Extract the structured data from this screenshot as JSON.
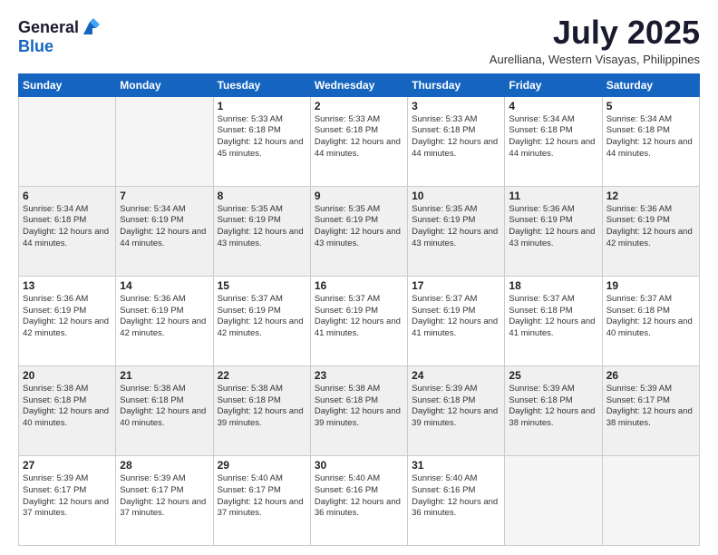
{
  "header": {
    "logo_line1": "General",
    "logo_line2": "Blue",
    "month": "July 2025",
    "location": "Aurelliana, Western Visayas, Philippines"
  },
  "weekdays": [
    "Sunday",
    "Monday",
    "Tuesday",
    "Wednesday",
    "Thursday",
    "Friday",
    "Saturday"
  ],
  "weeks": [
    [
      {
        "day": "",
        "sunrise": "",
        "sunset": "",
        "daylight": "",
        "empty": true
      },
      {
        "day": "",
        "sunrise": "",
        "sunset": "",
        "daylight": "",
        "empty": true
      },
      {
        "day": "1",
        "sunrise": "Sunrise: 5:33 AM",
        "sunset": "Sunset: 6:18 PM",
        "daylight": "Daylight: 12 hours and 45 minutes.",
        "empty": false
      },
      {
        "day": "2",
        "sunrise": "Sunrise: 5:33 AM",
        "sunset": "Sunset: 6:18 PM",
        "daylight": "Daylight: 12 hours and 44 minutes.",
        "empty": false
      },
      {
        "day": "3",
        "sunrise": "Sunrise: 5:33 AM",
        "sunset": "Sunset: 6:18 PM",
        "daylight": "Daylight: 12 hours and 44 minutes.",
        "empty": false
      },
      {
        "day": "4",
        "sunrise": "Sunrise: 5:34 AM",
        "sunset": "Sunset: 6:18 PM",
        "daylight": "Daylight: 12 hours and 44 minutes.",
        "empty": false
      },
      {
        "day": "5",
        "sunrise": "Sunrise: 5:34 AM",
        "sunset": "Sunset: 6:18 PM",
        "daylight": "Daylight: 12 hours and 44 minutes.",
        "empty": false
      }
    ],
    [
      {
        "day": "6",
        "sunrise": "Sunrise: 5:34 AM",
        "sunset": "Sunset: 6:18 PM",
        "daylight": "Daylight: 12 hours and 44 minutes.",
        "empty": false
      },
      {
        "day": "7",
        "sunrise": "Sunrise: 5:34 AM",
        "sunset": "Sunset: 6:19 PM",
        "daylight": "Daylight: 12 hours and 44 minutes.",
        "empty": false
      },
      {
        "day": "8",
        "sunrise": "Sunrise: 5:35 AM",
        "sunset": "Sunset: 6:19 PM",
        "daylight": "Daylight: 12 hours and 43 minutes.",
        "empty": false
      },
      {
        "day": "9",
        "sunrise": "Sunrise: 5:35 AM",
        "sunset": "Sunset: 6:19 PM",
        "daylight": "Daylight: 12 hours and 43 minutes.",
        "empty": false
      },
      {
        "day": "10",
        "sunrise": "Sunrise: 5:35 AM",
        "sunset": "Sunset: 6:19 PM",
        "daylight": "Daylight: 12 hours and 43 minutes.",
        "empty": false
      },
      {
        "day": "11",
        "sunrise": "Sunrise: 5:36 AM",
        "sunset": "Sunset: 6:19 PM",
        "daylight": "Daylight: 12 hours and 43 minutes.",
        "empty": false
      },
      {
        "day": "12",
        "sunrise": "Sunrise: 5:36 AM",
        "sunset": "Sunset: 6:19 PM",
        "daylight": "Daylight: 12 hours and 42 minutes.",
        "empty": false
      }
    ],
    [
      {
        "day": "13",
        "sunrise": "Sunrise: 5:36 AM",
        "sunset": "Sunset: 6:19 PM",
        "daylight": "Daylight: 12 hours and 42 minutes.",
        "empty": false
      },
      {
        "day": "14",
        "sunrise": "Sunrise: 5:36 AM",
        "sunset": "Sunset: 6:19 PM",
        "daylight": "Daylight: 12 hours and 42 minutes.",
        "empty": false
      },
      {
        "day": "15",
        "sunrise": "Sunrise: 5:37 AM",
        "sunset": "Sunset: 6:19 PM",
        "daylight": "Daylight: 12 hours and 42 minutes.",
        "empty": false
      },
      {
        "day": "16",
        "sunrise": "Sunrise: 5:37 AM",
        "sunset": "Sunset: 6:19 PM",
        "daylight": "Daylight: 12 hours and 41 minutes.",
        "empty": false
      },
      {
        "day": "17",
        "sunrise": "Sunrise: 5:37 AM",
        "sunset": "Sunset: 6:19 PM",
        "daylight": "Daylight: 12 hours and 41 minutes.",
        "empty": false
      },
      {
        "day": "18",
        "sunrise": "Sunrise: 5:37 AM",
        "sunset": "Sunset: 6:18 PM",
        "daylight": "Daylight: 12 hours and 41 minutes.",
        "empty": false
      },
      {
        "day": "19",
        "sunrise": "Sunrise: 5:37 AM",
        "sunset": "Sunset: 6:18 PM",
        "daylight": "Daylight: 12 hours and 40 minutes.",
        "empty": false
      }
    ],
    [
      {
        "day": "20",
        "sunrise": "Sunrise: 5:38 AM",
        "sunset": "Sunset: 6:18 PM",
        "daylight": "Daylight: 12 hours and 40 minutes.",
        "empty": false
      },
      {
        "day": "21",
        "sunrise": "Sunrise: 5:38 AM",
        "sunset": "Sunset: 6:18 PM",
        "daylight": "Daylight: 12 hours and 40 minutes.",
        "empty": false
      },
      {
        "day": "22",
        "sunrise": "Sunrise: 5:38 AM",
        "sunset": "Sunset: 6:18 PM",
        "daylight": "Daylight: 12 hours and 39 minutes.",
        "empty": false
      },
      {
        "day": "23",
        "sunrise": "Sunrise: 5:38 AM",
        "sunset": "Sunset: 6:18 PM",
        "daylight": "Daylight: 12 hours and 39 minutes.",
        "empty": false
      },
      {
        "day": "24",
        "sunrise": "Sunrise: 5:39 AM",
        "sunset": "Sunset: 6:18 PM",
        "daylight": "Daylight: 12 hours and 39 minutes.",
        "empty": false
      },
      {
        "day": "25",
        "sunrise": "Sunrise: 5:39 AM",
        "sunset": "Sunset: 6:18 PM",
        "daylight": "Daylight: 12 hours and 38 minutes.",
        "empty": false
      },
      {
        "day": "26",
        "sunrise": "Sunrise: 5:39 AM",
        "sunset": "Sunset: 6:17 PM",
        "daylight": "Daylight: 12 hours and 38 minutes.",
        "empty": false
      }
    ],
    [
      {
        "day": "27",
        "sunrise": "Sunrise: 5:39 AM",
        "sunset": "Sunset: 6:17 PM",
        "daylight": "Daylight: 12 hours and 37 minutes.",
        "empty": false
      },
      {
        "day": "28",
        "sunrise": "Sunrise: 5:39 AM",
        "sunset": "Sunset: 6:17 PM",
        "daylight": "Daylight: 12 hours and 37 minutes.",
        "empty": false
      },
      {
        "day": "29",
        "sunrise": "Sunrise: 5:40 AM",
        "sunset": "Sunset: 6:17 PM",
        "daylight": "Daylight: 12 hours and 37 minutes.",
        "empty": false
      },
      {
        "day": "30",
        "sunrise": "Sunrise: 5:40 AM",
        "sunset": "Sunset: 6:16 PM",
        "daylight": "Daylight: 12 hours and 36 minutes.",
        "empty": false
      },
      {
        "day": "31",
        "sunrise": "Sunrise: 5:40 AM",
        "sunset": "Sunset: 6:16 PM",
        "daylight": "Daylight: 12 hours and 36 minutes.",
        "empty": false
      },
      {
        "day": "",
        "sunrise": "",
        "sunset": "",
        "daylight": "",
        "empty": true
      },
      {
        "day": "",
        "sunrise": "",
        "sunset": "",
        "daylight": "",
        "empty": true
      }
    ]
  ]
}
